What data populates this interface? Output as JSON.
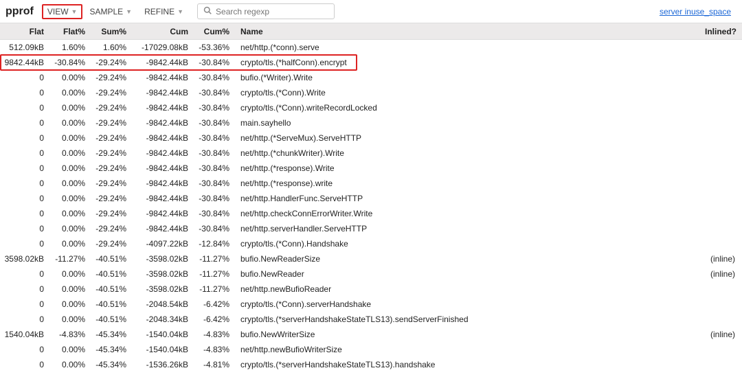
{
  "topbar": {
    "logo": "pprof",
    "menu": {
      "view": "VIEW",
      "sample": "SAMPLE",
      "refine": "REFINE"
    },
    "search_placeholder": "Search regexp",
    "profile_link": "server inuse_space"
  },
  "columns": {
    "flat": "Flat",
    "flatp": "Flat%",
    "sump": "Sum%",
    "cum": "Cum",
    "cump": "Cum%",
    "name": "Name",
    "inlined": "Inlined?"
  },
  "rows": [
    {
      "flat": "512.09kB",
      "flatp": "1.60%",
      "sump": "1.60%",
      "cum": "-17029.08kB",
      "cump": "-53.36%",
      "name": "net/http.(*conn).serve",
      "inlined": "",
      "hl": false
    },
    {
      "flat": "9842.44kB",
      "flatp": "-30.84%",
      "sump": "-29.24%",
      "cum": "-9842.44kB",
      "cump": "-30.84%",
      "name": "crypto/tls.(*halfConn).encrypt",
      "inlined": "",
      "hl": true
    },
    {
      "flat": "0",
      "flatp": "0.00%",
      "sump": "-29.24%",
      "cum": "-9842.44kB",
      "cump": "-30.84%",
      "name": "bufio.(*Writer).Write",
      "inlined": "",
      "hl": false
    },
    {
      "flat": "0",
      "flatp": "0.00%",
      "sump": "-29.24%",
      "cum": "-9842.44kB",
      "cump": "-30.84%",
      "name": "crypto/tls.(*Conn).Write",
      "inlined": "",
      "hl": false
    },
    {
      "flat": "0",
      "flatp": "0.00%",
      "sump": "-29.24%",
      "cum": "-9842.44kB",
      "cump": "-30.84%",
      "name": "crypto/tls.(*Conn).writeRecordLocked",
      "inlined": "",
      "hl": false
    },
    {
      "flat": "0",
      "flatp": "0.00%",
      "sump": "-29.24%",
      "cum": "-9842.44kB",
      "cump": "-30.84%",
      "name": "main.sayhello",
      "inlined": "",
      "hl": false
    },
    {
      "flat": "0",
      "flatp": "0.00%",
      "sump": "-29.24%",
      "cum": "-9842.44kB",
      "cump": "-30.84%",
      "name": "net/http.(*ServeMux).ServeHTTP",
      "inlined": "",
      "hl": false
    },
    {
      "flat": "0",
      "flatp": "0.00%",
      "sump": "-29.24%",
      "cum": "-9842.44kB",
      "cump": "-30.84%",
      "name": "net/http.(*chunkWriter).Write",
      "inlined": "",
      "hl": false
    },
    {
      "flat": "0",
      "flatp": "0.00%",
      "sump": "-29.24%",
      "cum": "-9842.44kB",
      "cump": "-30.84%",
      "name": "net/http.(*response).Write",
      "inlined": "",
      "hl": false
    },
    {
      "flat": "0",
      "flatp": "0.00%",
      "sump": "-29.24%",
      "cum": "-9842.44kB",
      "cump": "-30.84%",
      "name": "net/http.(*response).write",
      "inlined": "",
      "hl": false
    },
    {
      "flat": "0",
      "flatp": "0.00%",
      "sump": "-29.24%",
      "cum": "-9842.44kB",
      "cump": "-30.84%",
      "name": "net/http.HandlerFunc.ServeHTTP",
      "inlined": "",
      "hl": false
    },
    {
      "flat": "0",
      "flatp": "0.00%",
      "sump": "-29.24%",
      "cum": "-9842.44kB",
      "cump": "-30.84%",
      "name": "net/http.checkConnErrorWriter.Write",
      "inlined": "",
      "hl": false
    },
    {
      "flat": "0",
      "flatp": "0.00%",
      "sump": "-29.24%",
      "cum": "-9842.44kB",
      "cump": "-30.84%",
      "name": "net/http.serverHandler.ServeHTTP",
      "inlined": "",
      "hl": false
    },
    {
      "flat": "0",
      "flatp": "0.00%",
      "sump": "-29.24%",
      "cum": "-4097.22kB",
      "cump": "-12.84%",
      "name": "crypto/tls.(*Conn).Handshake",
      "inlined": "",
      "hl": false
    },
    {
      "flat": "3598.02kB",
      "flatp": "-11.27%",
      "sump": "-40.51%",
      "cum": "-3598.02kB",
      "cump": "-11.27%",
      "name": "bufio.NewReaderSize",
      "inlined": "(inline)",
      "hl": false
    },
    {
      "flat": "0",
      "flatp": "0.00%",
      "sump": "-40.51%",
      "cum": "-3598.02kB",
      "cump": "-11.27%",
      "name": "bufio.NewReader",
      "inlined": "(inline)",
      "hl": false
    },
    {
      "flat": "0",
      "flatp": "0.00%",
      "sump": "-40.51%",
      "cum": "-3598.02kB",
      "cump": "-11.27%",
      "name": "net/http.newBufioReader",
      "inlined": "",
      "hl": false
    },
    {
      "flat": "0",
      "flatp": "0.00%",
      "sump": "-40.51%",
      "cum": "-2048.54kB",
      "cump": "-6.42%",
      "name": "crypto/tls.(*Conn).serverHandshake",
      "inlined": "",
      "hl": false
    },
    {
      "flat": "0",
      "flatp": "0.00%",
      "sump": "-40.51%",
      "cum": "-2048.34kB",
      "cump": "-6.42%",
      "name": "crypto/tls.(*serverHandshakeStateTLS13).sendServerFinished",
      "inlined": "",
      "hl": false
    },
    {
      "flat": "1540.04kB",
      "flatp": "-4.83%",
      "sump": "-45.34%",
      "cum": "-1540.04kB",
      "cump": "-4.83%",
      "name": "bufio.NewWriterSize",
      "inlined": "(inline)",
      "hl": false
    },
    {
      "flat": "0",
      "flatp": "0.00%",
      "sump": "-45.34%",
      "cum": "-1540.04kB",
      "cump": "-4.83%",
      "name": "net/http.newBufioWriterSize",
      "inlined": "",
      "hl": false
    },
    {
      "flat": "0",
      "flatp": "0.00%",
      "sump": "-45.34%",
      "cum": "-1536.26kB",
      "cump": "-4.81%",
      "name": "crypto/tls.(*serverHandshakeStateTLS13).handshake",
      "inlined": "",
      "hl": false
    }
  ]
}
